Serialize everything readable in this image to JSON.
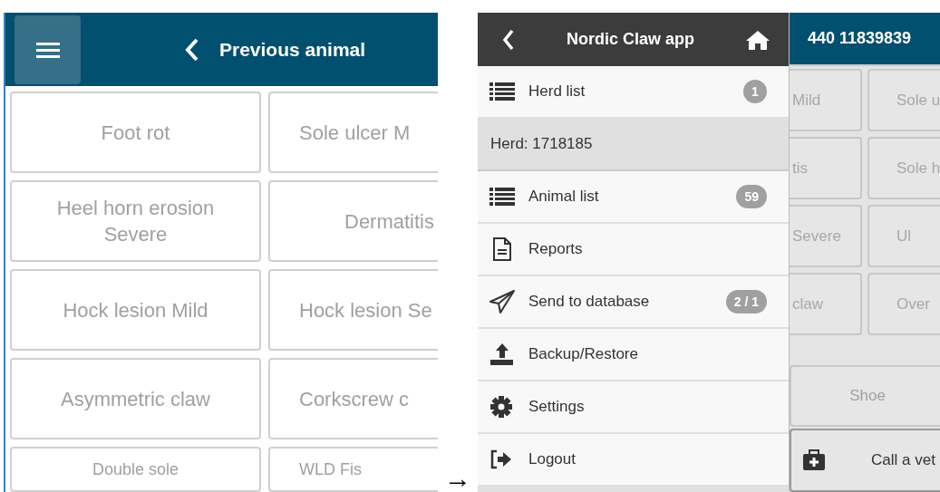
{
  "left_screen": {
    "header": {
      "title": "Previous animal"
    },
    "diagnoses": [
      [
        "Foot rot",
        "Sole ulcer M"
      ],
      [
        "Heel horn erosion Severe",
        "Dermatitis"
      ],
      [
        "Hock lesion Mild",
        "Hock lesion Se"
      ],
      [
        "Asymmetric claw",
        "Corkscrew c"
      ],
      [
        "Double sole",
        "WLD Fis"
      ]
    ]
  },
  "arrow": "→",
  "right_screen": {
    "menu_header": {
      "title": "Nordic Claw app"
    },
    "animal_id": "440 11839839",
    "menu": [
      {
        "kind": "item",
        "label": "Herd list",
        "badge": "1"
      },
      {
        "kind": "heading",
        "label": "Herd: 1718185"
      },
      {
        "kind": "item",
        "label": "Animal list",
        "badge": "59"
      },
      {
        "kind": "item",
        "label": "Reports"
      },
      {
        "kind": "item",
        "label": "Send to database",
        "badge": "2 / 1"
      },
      {
        "kind": "item",
        "label": "Backup/Restore"
      },
      {
        "kind": "item",
        "label": "Settings"
      },
      {
        "kind": "item",
        "label": "Logout"
      }
    ],
    "background_buttons": [
      [
        "Mild",
        "Sole u"
      ],
      [
        "tis",
        "Sole h"
      ],
      [
        "Severe",
        "Ul"
      ],
      [
        "claw",
        "Over"
      ]
    ],
    "shoe_button": "Shoe",
    "call_vet_button": "Call a vet"
  }
}
